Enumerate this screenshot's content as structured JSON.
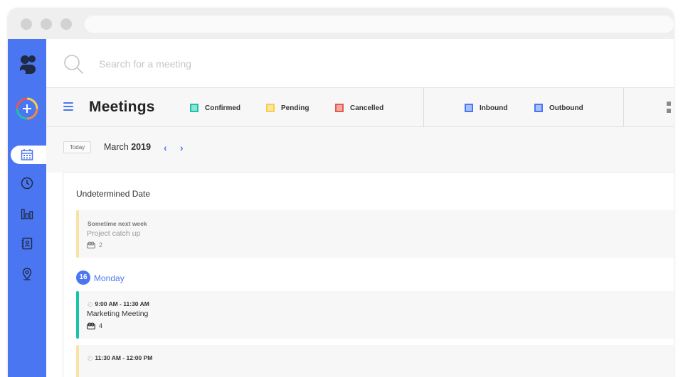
{
  "search": {
    "placeholder": "Search for a meeting"
  },
  "toolbar": {
    "title": "Meetings",
    "status_legend": [
      {
        "label": "Confirmed",
        "color": "#1cc3a8"
      },
      {
        "label": "Pending",
        "color": "#f7cf4a"
      },
      {
        "label": "Cancelled",
        "color": "#e5584f"
      }
    ],
    "direction_legend": [
      {
        "label": "Inbound",
        "color": "#4a76f2"
      },
      {
        "label": "Outbound",
        "color": "#4a76f2"
      }
    ]
  },
  "datenav": {
    "today_label": "Today",
    "month": "March",
    "year": "2019"
  },
  "sidebar": {
    "logo": "s-logo-icon",
    "items": [
      "add-meeting",
      "calendar",
      "clock",
      "stats",
      "contacts",
      "location"
    ]
  },
  "undetermined": {
    "title": "Undetermined Date",
    "event": {
      "time": "Sometime next week",
      "title": "Project catch up",
      "attendees": "2",
      "status_color": "#f7e4a4"
    }
  },
  "day": {
    "number": "16",
    "name": "Monday",
    "events": [
      {
        "time": "9:00 AM - 11:30 AM",
        "title": "Marketing Meeting",
        "attendees": "4",
        "status_color": "#1cc3a8"
      },
      {
        "time": "11:30 AM - 12:00 PM",
        "title": "",
        "attendees": "",
        "status_color": "#f7e4a4"
      }
    ]
  }
}
